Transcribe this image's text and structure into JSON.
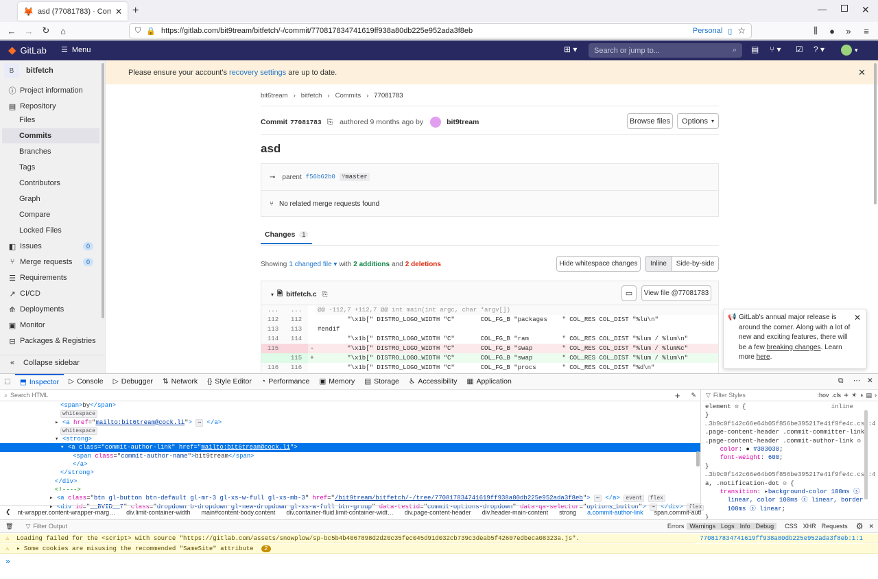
{
  "browser": {
    "tab_title": "asd (77081783) · Commits · bit",
    "url": "https://gitlab.com/bit9tream/bitfetch/-/commit/770817834741619ff938a80db225e952ada3f8eb",
    "profile": "Personal"
  },
  "gitlab": {
    "brand": "GitLab",
    "menu_label": "Menu",
    "search_placeholder": "Search or jump to..."
  },
  "sidebar": {
    "project_initial": "B",
    "project_name": "bitfetch",
    "items": [
      {
        "label": "Project information"
      },
      {
        "label": "Repository"
      },
      {
        "label": "Files"
      },
      {
        "label": "Commits"
      },
      {
        "label": "Branches"
      },
      {
        "label": "Tags"
      },
      {
        "label": "Contributors"
      },
      {
        "label": "Graph"
      },
      {
        "label": "Compare"
      },
      {
        "label": "Locked Files"
      },
      {
        "label": "Issues",
        "badge": "0"
      },
      {
        "label": "Merge requests",
        "badge": "0"
      },
      {
        "label": "Requirements"
      },
      {
        "label": "CI/CD"
      },
      {
        "label": "Deployments"
      },
      {
        "label": "Monitor"
      },
      {
        "label": "Packages & Registries"
      }
    ],
    "collapse_label": "Collapse sidebar"
  },
  "alert": {
    "before": "Please ensure your account's ",
    "link": "recovery settings",
    "after": " are up to date."
  },
  "breadcrumb": [
    "bit6tream",
    "bitfetch",
    "Commits",
    "77081783"
  ],
  "commit": {
    "label": "Commit",
    "sha": "77081783",
    "authored": "authored 9 months ago by",
    "author": "bit9tream",
    "browse_files": "Browse files",
    "options": "Options",
    "title": "asd",
    "parent_label": "parent",
    "parent_sha": "f56b62b0",
    "branch": "master",
    "mr_text": "No related merge requests found"
  },
  "changes": {
    "tab_label": "Changes",
    "tab_count": "1",
    "showing": "Showing",
    "changed_file": "1 changed file",
    "with": "with",
    "additions": "2 additions",
    "and": "and",
    "deletions": "2 deletions",
    "hide_whitespace": "Hide whitespace changes",
    "inline": "Inline",
    "side_by_side": "Side-by-side",
    "file_name": "bitfetch.c",
    "view_file": "View file @77081783"
  },
  "diff_lines": [
    {
      "n1": "...",
      "n2": "...",
      "sign": "",
      "code": "@@ -112,7 +112,7 @@ int main(int argc, char *argv[])",
      "type": "meta"
    },
    {
      "n1": "112",
      "n2": "112",
      "sign": "",
      "code": "        \"\\x1b[\" DISTRO_LOGO_WIDTH \"C\"       COL_FG_B \"packages    \" COL_RES COL_DIST \"%lu\\n\"",
      "type": "ctx"
    },
    {
      "n1": "113",
      "n2": "113",
      "sign": "",
      "code": "#endif",
      "type": "ctx"
    },
    {
      "n1": "114",
      "n2": "114",
      "sign": "",
      "code": "        \"\\x1b[\" DISTRO_LOGO_WIDTH \"C\"       COL_FG_B \"ram         \" COL_RES COL_DIST \"%lum / %lum\\n\"",
      "type": "ctx"
    },
    {
      "n1": "115",
      "n2": "",
      "sign": "-",
      "code": "        \"\\x1b[\" DISTRO_LOGO_WIDTH \"C\"       COL_FG_B \"swap        \" COL_RES COL_DIST \"%lum / %lum%c\"",
      "type": "del"
    },
    {
      "n1": "",
      "n2": "115",
      "sign": "+",
      "code": "        \"\\x1b[\" DISTRO_LOGO_WIDTH \"C\"       COL_FG_B \"swap        \" COL_RES COL_DIST \"%lum / %lum\\n\"",
      "type": "add"
    },
    {
      "n1": "116",
      "n2": "116",
      "sign": "",
      "code": "        \"\\x1b[\" DISTRO_LOGO_WIDTH \"C\"       COL_FG_B \"procs       \" COL_RES COL_DIST \"%d\\n\"",
      "type": "ctx"
    }
  ],
  "popup": {
    "text1": "GitLab's annual major release is around the corner. Along with a lot of new and exciting features, there will be a few ",
    "link1": "breaking changes",
    "text2": ". Learn more ",
    "link2": "here",
    "text3": "."
  },
  "devtools": {
    "tabs": [
      "Inspector",
      "Console",
      "Debugger",
      "Network",
      "Style Editor",
      "Performance",
      "Memory",
      "Storage",
      "Accessibility",
      "Application"
    ],
    "search_html": "Search HTML",
    "filter_styles": "Filter Styles",
    "hov": ":hov",
    "cls": ".cls",
    "html_lines": [
      {
        "indent": 88,
        "html": "<span class=\"tg\">&lt;span&gt;</span>by<span class=\"tg\">&lt;/span&gt;</span>"
      },
      {
        "indent": 88,
        "html": "<span class=\"ws\">whitespace</span>"
      },
      {
        "indent": 80,
        "html": "▸ <span class=\"tg\">&lt;a</span> <span class=\"at\">href</span>=\"<span class=\"av\"><u>mailto:bit6tream@cock.li</u></span>\"<span class=\"tg\">&gt;</span> <span class=\"ws\">⋯</span> <span class=\"tg\">&lt;/a&gt;</span>"
      },
      {
        "indent": 88,
        "html": "<span class=\"ws\">whitespace</span>"
      },
      {
        "indent": 80,
        "html": "▾ <span class=\"tg\">&lt;strong&gt;</span>"
      },
      {
        "indent": 88,
        "html": "▾ <span class=\"tg\">&lt;a</span> <span class=\"at\">class</span>=\"<span class=\"av\">commit-author-link</span>\" <span class=\"at\">href</span>=\"<span class=\"av\"><u>mailto:bit6tream@cock.li</u></span>\"<span class=\"tg\">&gt;</span>",
        "selected": true
      },
      {
        "indent": 106,
        "html": "<span class=\"tg\">&lt;span</span> <span class=\"at\">class</span>=\"<span class=\"av\">commit-author-name</span>\"<span class=\"tg\">&gt;</span>bit9tream<span class=\"tg\">&lt;/span&gt;</span>"
      },
      {
        "indent": 106,
        "html": "<span class=\"tg\">&lt;/a&gt;</span>"
      },
      {
        "indent": 88,
        "html": "<span class=\"tg\">&lt;/strong&gt;</span>"
      },
      {
        "indent": 80,
        "html": "<span class=\"tg\">&lt;/div&gt;</span>"
      },
      {
        "indent": 80,
        "html": "<span style=\"color:#058b00\">&lt;!----&gt;</span>"
      },
      {
        "indent": 72,
        "html": "▸ <span class=\"tg\">&lt;a</span> <span class=\"at\">class</span>=\"<span class=\"av\">btn gl-button btn-default gl-mr-3 gl-xs-w-full gl-xs-mb-3</span>\" <span class=\"at\">href</span>=\"<span class=\"av\"><u>/bit9tream/bitfetch/-/tree/770817834741619ff938a80db225e952ada3f8eb</u></span>\"<span class=\"tg\">&gt;</span> <span class=\"ws\">⋯</span> <span class=\"tg\">&lt;/a&gt;</span> <span class=\"ws\">event</span> <span class=\"ws\">flex</span>"
      },
      {
        "indent": 72,
        "html": "▸ <span class=\"tg\">&lt;div</span> <span class=\"at\">id</span>=\"<span class=\"av\">__BVID__7</span>\" <span class=\"at\">class</span>=\"<span class=\"av\">dropdown b-dropdown gl-new-dropdown gl-xs-w-full btn-group</span>\" <span class=\"at\">data-testid</span>=\"<span class=\"av\">commit-options-dropdown</span>\" <span class=\"at\">data-qa-selector</span>=\"<span class=\"av\">options_button</span>\"<span class=\"tg\">&gt;</span> <span class=\"ws\">⋯</span> <span class=\"tg\">&lt;/div&gt;</span> <span class=\"ws\">flex</span>"
      }
    ],
    "css_lines": [
      "element <span style='color:#888'>⚙</span> {                       <span style='color:#666'>inline</span>",
      "}",
      "<span style='color:#666'>…3b9c0f142c66e64b05f856be395217e41f9fe4c.css:4</span>",
      ".page-content-header .commit-committer-link,",
      ".page-content-header .commit-author-link <span style='color:#888'>⚙</span> {",
      "    <span style='color:#dd00a9'>color</span>: <span style='color:#303030'>●</span> <span style='color:#003eaa'>#303030</span>;",
      "    <span style='color:#dd00a9'>font-weight</span>: <span style='color:#003eaa'>600</span>;",
      "}",
      "<span style='color:#666'>…3b9c0f142c66e64b05f856be395217e41f9fe4c.css:4</span>",
      "a, .notification-dot <span style='color:#888'>⚙</span> {",
      "    <span style='color:#dd00a9'>transition</span>: ▸<span style='color:#003eaa'>background-color 100ms ⓢ</span>",
      "      <span style='color:#003eaa'>linear, color 100ms ⓢ linear, border</span>",
      "      <span style='color:#003eaa'>100ms ⓢ linear</span>;",
      "}",
      "<span style='color:#666'>…3b9c0f142c66e64b05f856be395217e41f9fe4c.css:4</span>"
    ],
    "breadcrumbs": [
      "nt-wrapper.content-wrapper-marg…",
      "div.limit-container-width",
      "main#content-body.content",
      "div.container-fluid.limit-container-widt…",
      "div.page-content-header",
      "div.header-main-content",
      "strong",
      "a.commit-author-link",
      "span.commit-author-name"
    ],
    "filter_output": "Filter Output",
    "console_filters": [
      "Errors",
      "Warnings",
      "Logs",
      "Info",
      "Debug",
      "CSS",
      "XHR",
      "Requests"
    ],
    "messages": [
      {
        "text": "Loading failed for the <script> with source \"https://gitlab.com/assets/snowplow/sp-bc5b4b4067898d2d20c35fec045d91d032cb739c3deab5f42607edbeca08323a.js\".",
        "source": "770817834741619ff938a80db225e952ada3f8eb:1:1"
      },
      {
        "text": "Some cookies are misusing the recommended \"SameSite\" attribute",
        "count": "2"
      }
    ]
  },
  "colors": {
    "gitlab_nav": "#292961",
    "link": "#1f75cb",
    "addition": "#108548",
    "deletion": "#dd2b0e",
    "devtools_accent": "#0074e8"
  }
}
